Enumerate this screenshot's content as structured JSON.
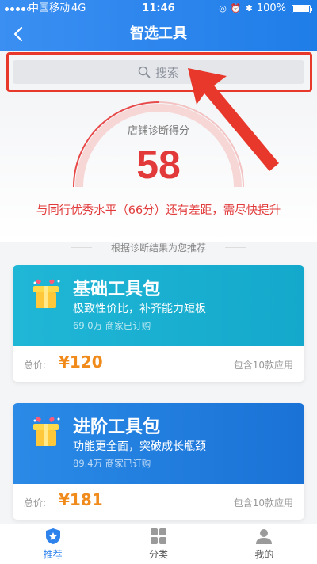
{
  "status_bar": {
    "carrier": "中国移动",
    "network": "4G",
    "time": "11:46",
    "battery": "100%",
    "battery_level": 1.0,
    "signal_bars": 4
  },
  "nav": {
    "title": "智选工具",
    "back_icon": "chevron-left-icon"
  },
  "search": {
    "placeholder": "搜索",
    "icon": "search-icon",
    "highlight_color": "#e8372b"
  },
  "score": {
    "label": "店铺诊断得分",
    "value": "58",
    "message": "与同行优秀水平（66分）还有差距，需尽快提升",
    "color": "#e23a3a"
  },
  "recommend": {
    "title": "根据诊断结果为您推荐"
  },
  "cards": [
    {
      "name": "基础工具包",
      "desc": "极致性价比，补齐能力短板",
      "buyers": "69.0万 商家已订购",
      "price_label": "总价:",
      "price": "¥120",
      "app_count": "包含10款应用",
      "color": "#20b6d6",
      "icon": "gift-box-icon"
    },
    {
      "name": "进阶工具包",
      "desc": "功能更全面，突破成长瓶颈",
      "buyers": "89.4万 商家已订购",
      "price_label": "总价:",
      "price": "¥181",
      "app_count": "包含10款应用",
      "color": "#2a8ae6",
      "icon": "gift-box-icon"
    }
  ],
  "tabs": [
    {
      "label": "推荐",
      "icon": "star-shield-icon",
      "active": true
    },
    {
      "label": "分类",
      "icon": "grid-icon",
      "active": false
    },
    {
      "label": "我的",
      "icon": "user-icon",
      "active": false
    }
  ],
  "colors": {
    "header": "#2d82ec",
    "accent_red": "#e23a3a",
    "price_orange": "#f08a1a",
    "tab_active": "#2d82ec"
  }
}
